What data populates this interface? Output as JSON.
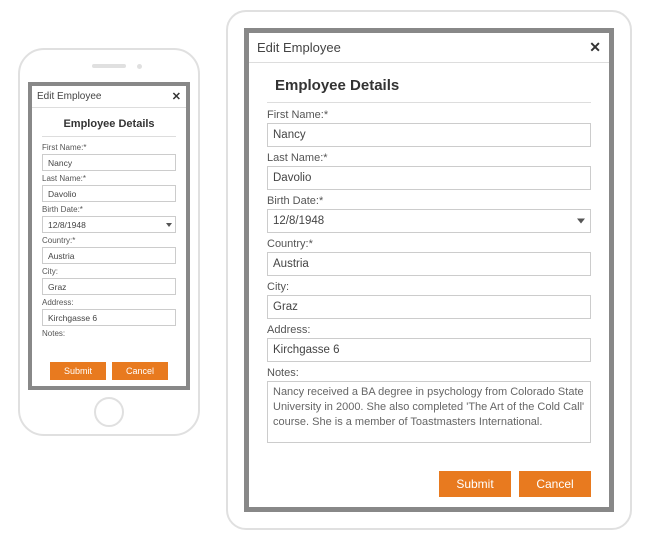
{
  "dialog": {
    "title": "Edit Employee",
    "section_title": "Employee Details",
    "submit_label": "Submit",
    "cancel_label": "Cancel"
  },
  "fields": {
    "first_name": {
      "label": "First Name:*",
      "value": "Nancy"
    },
    "last_name": {
      "label": "Last Name:*",
      "value": "Davolio"
    },
    "birth_date": {
      "label": "Birth Date:*",
      "value": "12/8/1948"
    },
    "country": {
      "label": "Country:*",
      "value": "Austria"
    },
    "city": {
      "label": "City:",
      "value": "Graz"
    },
    "address": {
      "label": "Address:",
      "value": "Kirchgasse 6"
    },
    "notes": {
      "label": "Notes:",
      "value": "Nancy received a BA degree in psychology from Colorado State University in 2000. She also completed 'The Art of the Cold Call' course. She is a member of Toastmasters International."
    }
  }
}
